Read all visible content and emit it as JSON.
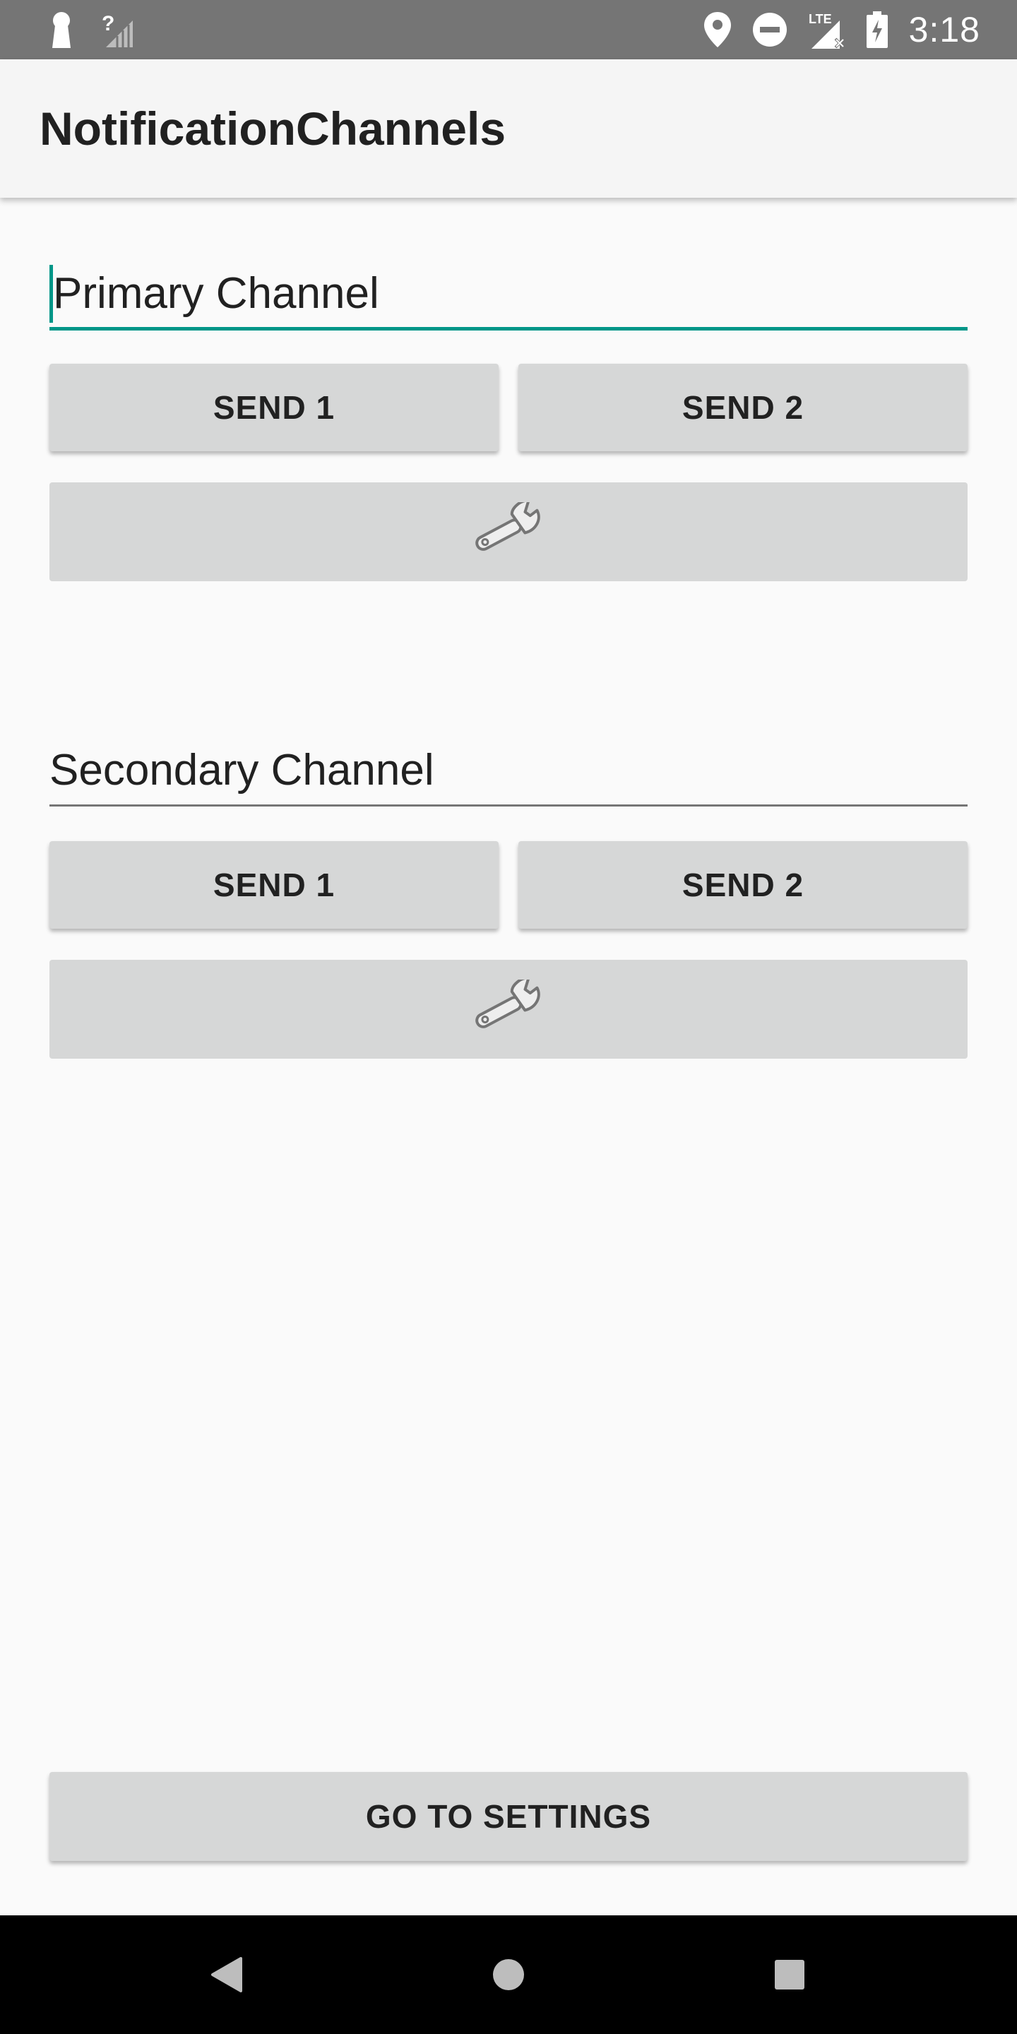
{
  "status_bar": {
    "time": "3:18",
    "icons": [
      "keyhole-icon",
      "no-signal-icon",
      "location-icon",
      "do-not-disturb-icon",
      "lte-no-signal-icon",
      "battery-charging-icon"
    ]
  },
  "app_bar": {
    "title": "NotificationChannels"
  },
  "primary_channel": {
    "input_value": "Primary Channel",
    "send1_label": "SEND 1",
    "send2_label": "SEND 2",
    "settings_icon": "wrench-icon"
  },
  "secondary_channel": {
    "input_value": "Secondary Channel",
    "send1_label": "SEND 1",
    "send2_label": "SEND 2",
    "settings_icon": "wrench-icon"
  },
  "footer": {
    "go_to_settings_label": "GO TO SETTINGS"
  },
  "nav_bar": {
    "icons": [
      "back-icon",
      "home-icon",
      "recents-icon"
    ]
  },
  "colors": {
    "accent": "#009688",
    "status_bar": "#757575",
    "button": "#d6d7d7"
  }
}
